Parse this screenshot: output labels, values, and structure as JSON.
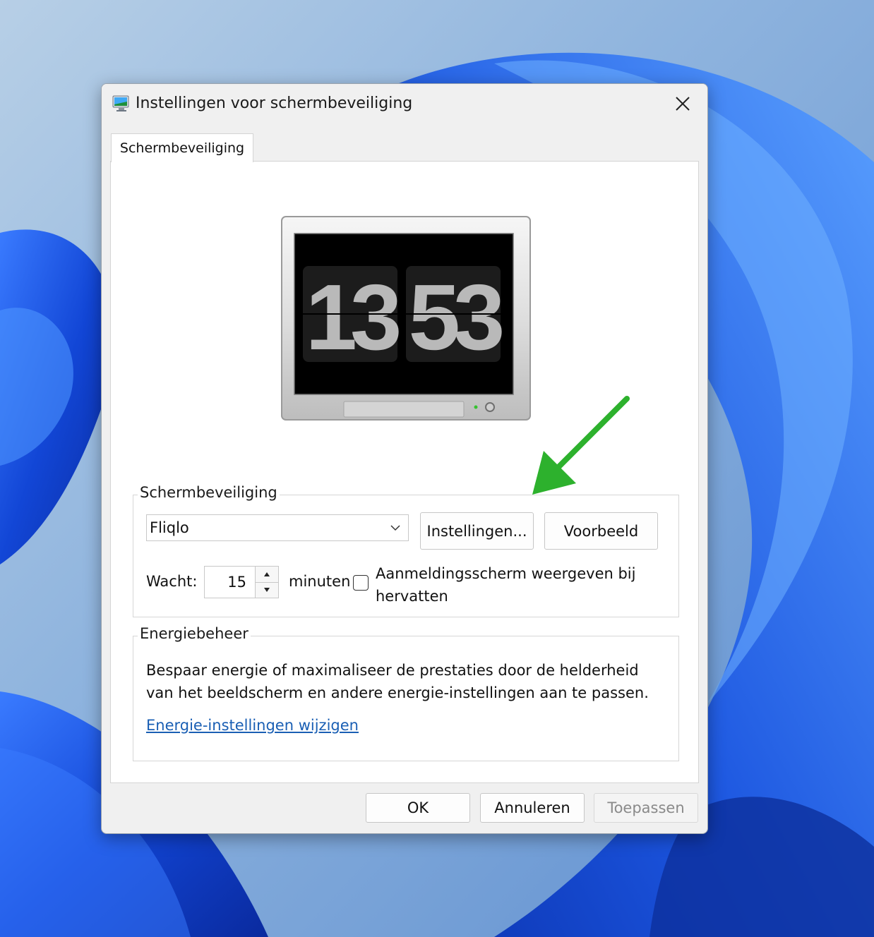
{
  "dialog": {
    "title": "Instellingen voor schermbeveiliging",
    "icon": "monitor-settings-icon",
    "close_icon": "close-icon"
  },
  "tabs": [
    {
      "label": "Schermbeveiliging",
      "active": true
    }
  ],
  "preview": {
    "clock_hours": "13",
    "clock_minutes": "53"
  },
  "screensaver_group": {
    "legend": "Schermbeveiliging",
    "selected": "Fliqlo",
    "settings_button": "Instellingen...",
    "preview_button": "Voorbeeld",
    "wait_label": "Wacht:",
    "wait_value": "15",
    "minutes_label": "minuten",
    "logon_checkbox_label": "Aanmeldingsscherm weergeven bij hervatten",
    "logon_checked": false
  },
  "energy_group": {
    "legend": "Energiebeheer",
    "description": "Bespaar energie of maximaliseer de prestaties door de helderheid van het beeldscherm en andere energie-instellingen aan te passen.",
    "link": "Energie-instellingen wijzigen"
  },
  "footer": {
    "ok": "OK",
    "cancel": "Annuleren",
    "apply": "Toepassen",
    "apply_disabled": true
  },
  "annotation": {
    "arrow_color": "#2db12d"
  },
  "colors": {
    "wallpaper_blue": "#1c56d8",
    "link": "#1a5fb4"
  }
}
